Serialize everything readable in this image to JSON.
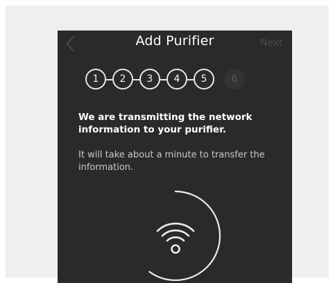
{
  "header": {
    "title": "Add Purifier",
    "next_label": "Next"
  },
  "steps": [
    {
      "label": "1",
      "state": "done"
    },
    {
      "label": "2",
      "state": "done"
    },
    {
      "label": "3",
      "state": "done"
    },
    {
      "label": "4",
      "state": "done"
    },
    {
      "label": "5",
      "state": "done"
    },
    {
      "label": "6",
      "state": "current"
    }
  ],
  "message": {
    "headline": "We are transmitting the network information to your purifier.",
    "body": "It will take about a minute to transfer the information."
  },
  "progress": {
    "icon": "wifi-icon",
    "fraction": 0.6
  },
  "colors": {
    "screen_bg": "#2a2a2a",
    "outer_bg": "#efefef",
    "ring": "#ececec",
    "text": "#ffffff",
    "muted_text": "#c9c9c9"
  }
}
